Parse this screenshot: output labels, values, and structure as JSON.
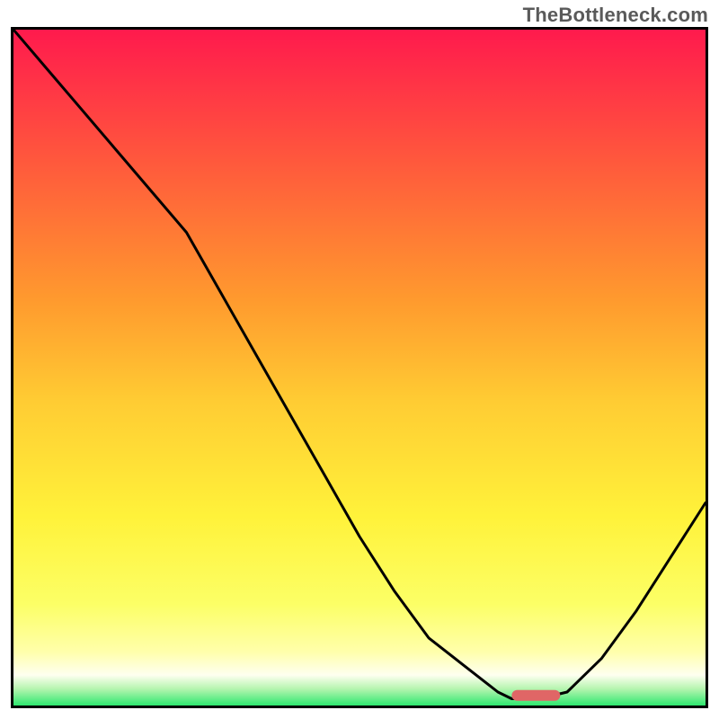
{
  "watermark": "TheBottleneck.com",
  "chart_data": {
    "type": "line",
    "title": "",
    "xlabel": "",
    "ylabel": "",
    "xlim": [
      0,
      100
    ],
    "ylim": [
      0,
      100
    ],
    "grid": false,
    "legend": false,
    "x": [
      0,
      5,
      10,
      15,
      20,
      25,
      30,
      35,
      40,
      45,
      50,
      55,
      60,
      65,
      70,
      72,
      76,
      80,
      85,
      90,
      95,
      100
    ],
    "values": [
      100,
      94,
      88,
      82,
      76,
      70,
      61,
      52,
      43,
      34,
      25,
      17,
      10,
      6,
      2,
      1,
      1,
      2,
      7,
      14,
      22,
      30
    ],
    "optimum_marker": {
      "x_start": 72,
      "x_end": 79,
      "y": 1.5,
      "color": "#e06666"
    },
    "gradient_stops": [
      {
        "offset": 0.0,
        "color": "#ff1a4d"
      },
      {
        "offset": 0.2,
        "color": "#ff5a3c"
      },
      {
        "offset": 0.4,
        "color": "#ff9a2e"
      },
      {
        "offset": 0.55,
        "color": "#ffcc33"
      },
      {
        "offset": 0.72,
        "color": "#fff23a"
      },
      {
        "offset": 0.85,
        "color": "#fcff66"
      },
      {
        "offset": 0.92,
        "color": "#ffffaa"
      },
      {
        "offset": 0.955,
        "color": "#fefff0"
      },
      {
        "offset": 0.975,
        "color": "#b7f5b0"
      },
      {
        "offset": 1.0,
        "color": "#2ee86f"
      }
    ]
  }
}
